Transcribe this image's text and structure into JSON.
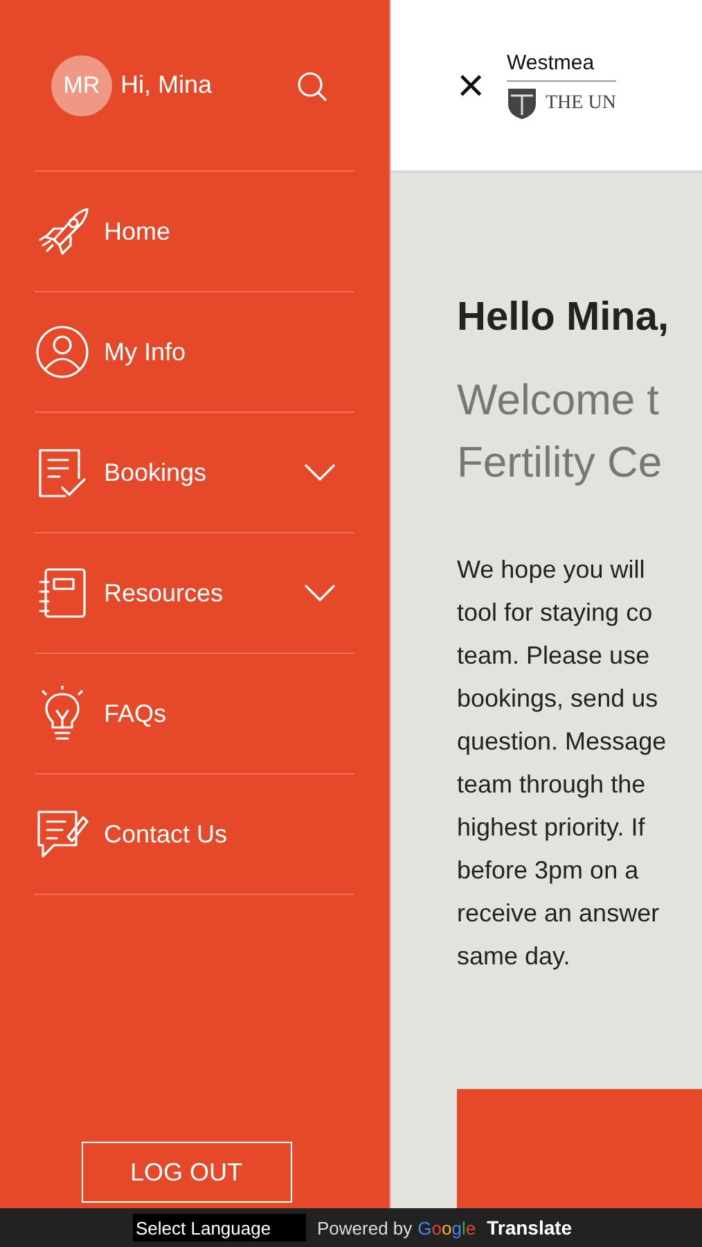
{
  "sidebar": {
    "avatar": "MR",
    "greeting": "Hi, Mina",
    "items": [
      {
        "label": "Home",
        "kind": "link"
      },
      {
        "label": "My Info",
        "kind": "link"
      },
      {
        "label": "Bookings",
        "kind": "menu",
        "expanded": false
      },
      {
        "label": "Resources",
        "kind": "menu",
        "expanded": false
      },
      {
        "label": "FAQs",
        "kind": "link"
      },
      {
        "label": "Contact Us",
        "kind": "link"
      }
    ],
    "logout": "LOG OUT"
  },
  "header": {
    "close": "×",
    "brand": "Westmea",
    "university": "THE UN"
  },
  "content": {
    "heading": "Hello Mina,",
    "subheading": [
      "Welcome t",
      "Fertility Ce"
    ],
    "body": [
      "We hope you will",
      "tool for staying co",
      "team. Please use",
      "bookings, send us",
      "question. Message",
      "team through the",
      "highest priority. If",
      "before 3pm on a",
      "receive an answer",
      "same day."
    ]
  },
  "translate_bar": {
    "select": "Select Language",
    "powered_by": "Powered by",
    "google": "Google",
    "translate": "Translate"
  }
}
